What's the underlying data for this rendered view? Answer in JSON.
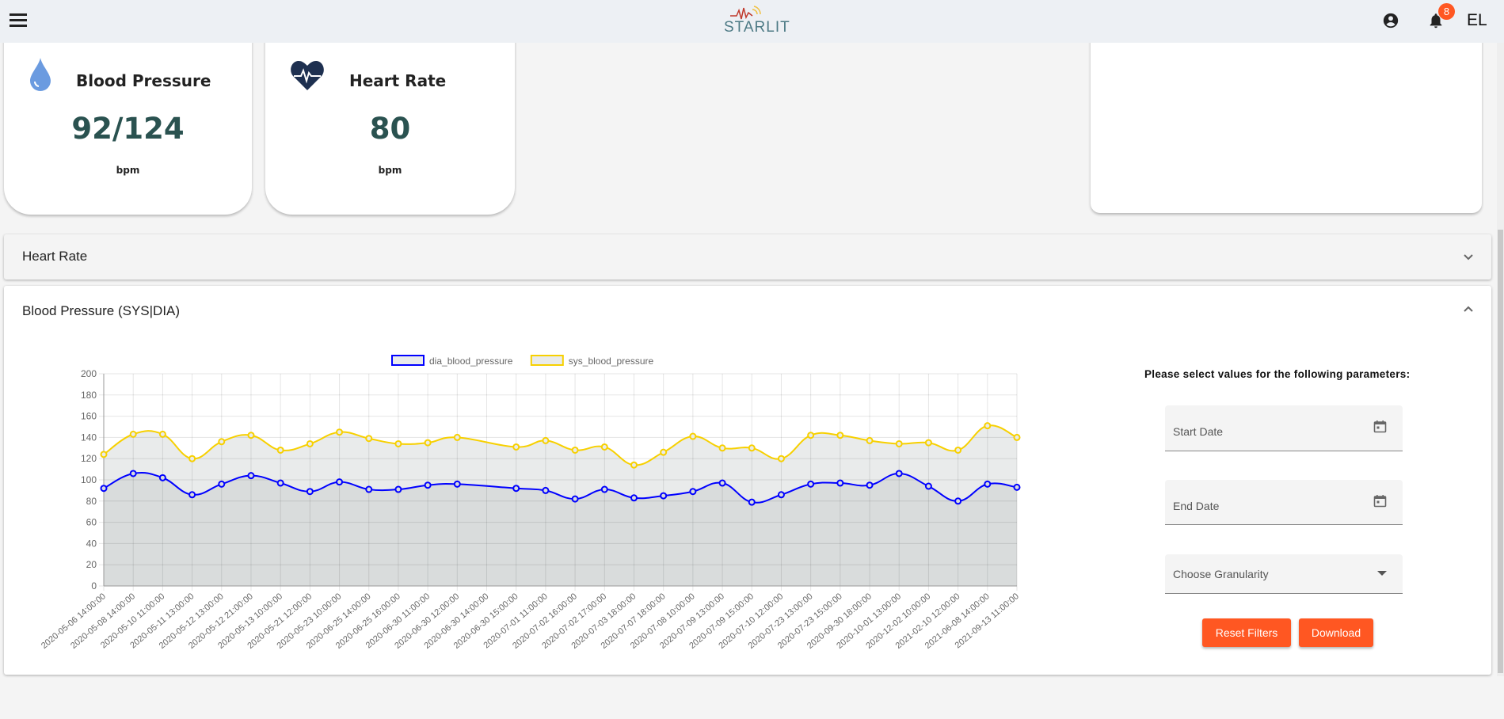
{
  "header": {
    "logo_text": "STARLIT",
    "notification_count": "8",
    "user_initials": "EL",
    "icons": [
      "menu-icon",
      "account-circle-icon",
      "bell-icon"
    ]
  },
  "cards": [
    {
      "title": "Blood Pressure",
      "value": "92/124",
      "unit": "bpm",
      "icon": "water-drop-icon",
      "icon_color": "#6b9be0"
    },
    {
      "title": "Heart Rate",
      "value": "80",
      "unit": "bpm",
      "icon": "heart-pulse-icon",
      "icon_color": "#1e3050"
    }
  ],
  "accordions": {
    "heart_rate": {
      "title": "Heart Rate",
      "expanded": false
    },
    "blood_pressure": {
      "title": "Blood Pressure (SYS|DIA)",
      "expanded": true
    }
  },
  "filters": {
    "title": "Please select values for the following parameters:",
    "start_date": "Start Date",
    "end_date": "End Date",
    "granularity": "Choose Granularity",
    "reset": "Reset Filters",
    "download": "Download",
    "accent": "#ff5722"
  },
  "chart_data": {
    "type": "line",
    "ylim": [
      0,
      200
    ],
    "yticks": [
      0,
      20,
      40,
      60,
      80,
      100,
      120,
      140,
      160,
      180,
      200
    ],
    "grid": true,
    "legend": "top",
    "categories": [
      "2020-05-06 14:00:00",
      "2020-05-08 14:00:00",
      "2020-05-10 11:00:00",
      "2020-05-11 13:00:00",
      "2020-05-12 13:00:00",
      "2020-05-12 21:00:00",
      "2020-05-13 10:00:00",
      "2020-05-21 12:00:00",
      "2020-05-23 10:00:00",
      "2020-06-25 14:00:00",
      "2020-06-25 16:00:00",
      "2020-06-30 11:00:00",
      "2020-06-30 12:00:00",
      "2020-06-30 14:00:00",
      "2020-06-30 15:00:00",
      "2020-07-01 11:00:00",
      "2020-07-02 16:00:00",
      "2020-07-02 17:00:00",
      "2020-07-03 18:00:00",
      "2020-07-07 18:00:00",
      "2020-07-08 10:00:00",
      "2020-07-09 13:00:00",
      "2020-07-09 15:00:00",
      "2020-07-10 12:00:00",
      "2020-07-23 13:00:00",
      "2020-07-23 15:00:00",
      "2020-09-30 18:00:00",
      "2020-10-01 13:00:00",
      "2020-12-02 10:00:00",
      "2021-02-10 12:00:00",
      "2021-06-08 14:00:00",
      "2021-09-13 11:00:00"
    ],
    "series": [
      {
        "name": "dia_blood_pressure",
        "color": "#0000ff",
        "fill": "#d9dcdc",
        "values": [
          92,
          106,
          102,
          86,
          96,
          104,
          97,
          89,
          98,
          91,
          91,
          95,
          96,
          null,
          92,
          90,
          82,
          91,
          83,
          85,
          89,
          97,
          79,
          86,
          96,
          97,
          95,
          106,
          94,
          80,
          96,
          93
        ]
      },
      {
        "name": "sys_blood_pressure",
        "color": "#f7d000",
        "fill": "#e9ebeb",
        "values": [
          124,
          143,
          143,
          120,
          136,
          142,
          128,
          134,
          145,
          139,
          134,
          135,
          140,
          null,
          131,
          137,
          128,
          131,
          114,
          126,
          141,
          130,
          130,
          120,
          142,
          142,
          137,
          134,
          135,
          128,
          151,
          140
        ]
      }
    ]
  }
}
